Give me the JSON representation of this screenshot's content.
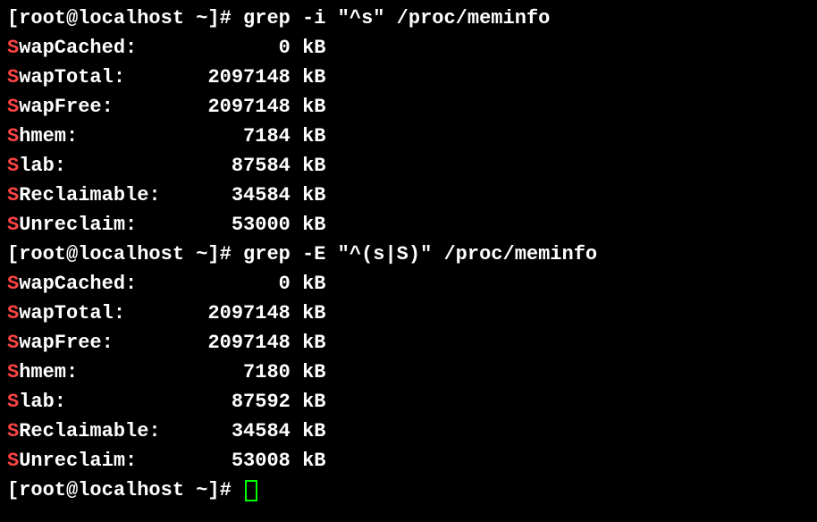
{
  "prompt_prefix": "[root@localhost ~]# ",
  "command1": "grep -i \"^s\" /proc/meminfo",
  "command2": "grep -E \"^(s|S)\" /proc/meminfo",
  "output1": [
    {
      "hl": "S",
      "label": "wapCached:",
      "value": "0",
      "unit": "kB"
    },
    {
      "hl": "S",
      "label": "wapTotal:",
      "value": "2097148",
      "unit": "kB"
    },
    {
      "hl": "S",
      "label": "wapFree:",
      "value": "2097148",
      "unit": "kB"
    },
    {
      "hl": "S",
      "label": "hmem:",
      "value": "7184",
      "unit": "kB"
    },
    {
      "hl": "S",
      "label": "lab:",
      "value": "87584",
      "unit": "kB"
    },
    {
      "hl": "S",
      "label": "Reclaimable:",
      "value": "34584",
      "unit": "kB"
    },
    {
      "hl": "S",
      "label": "Unreclaim:",
      "value": "53000",
      "unit": "kB"
    }
  ],
  "output2": [
    {
      "hl": "S",
      "label": "wapCached:",
      "value": "0",
      "unit": "kB"
    },
    {
      "hl": "S",
      "label": "wapTotal:",
      "value": "2097148",
      "unit": "kB"
    },
    {
      "hl": "S",
      "label": "wapFree:",
      "value": "2097148",
      "unit": "kB"
    },
    {
      "hl": "S",
      "label": "hmem:",
      "value": "7180",
      "unit": "kB"
    },
    {
      "hl": "S",
      "label": "lab:",
      "value": "87592",
      "unit": "kB"
    },
    {
      "hl": "S",
      "label": "Reclaimable:",
      "value": "34584",
      "unit": "kB"
    },
    {
      "hl": "S",
      "label": "Unreclaim:",
      "value": "53008",
      "unit": "kB"
    }
  ]
}
